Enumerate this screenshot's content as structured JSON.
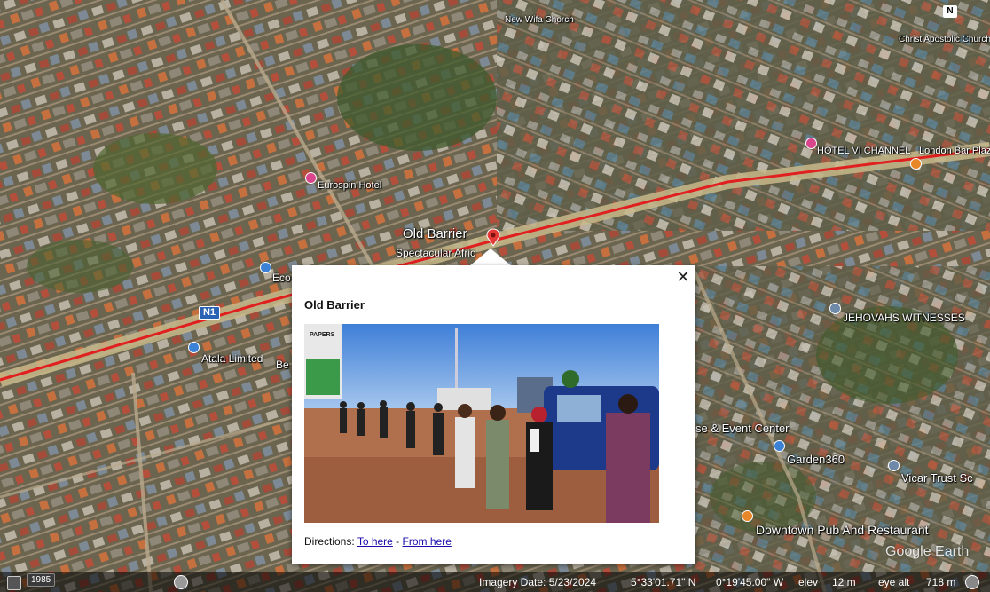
{
  "map": {
    "labels": {
      "new_life_chorch": "New Wifa Chorch",
      "christ_apostolic": "Christ Apostolic Church",
      "hotel": "HOTEL VI CHANNEL",
      "london_bar": "London Bar Plaz",
      "eurospin": "Eurospin Hotel",
      "old_barrier": "Old Barrier",
      "spectacular": "Spectacular Afric",
      "eco": "Eco",
      "atala": "Atala Limited",
      "be": "Be",
      "jehovah": "JEHOVAHS WITNESSES",
      "event_center": "se & Event Center",
      "garden": "Garden360",
      "vicar": "Vicar Trust Sc",
      "downtown": "Downtown Pub And Restaurant",
      "road_shield": "N1"
    },
    "compass": "N",
    "watermark": "Google Earth",
    "colors": {
      "road_line": "#e01f1f",
      "marker": "#e53935"
    }
  },
  "popup": {
    "title": "Old Barrier",
    "directions_prefix": "Directions: ",
    "to_here": "To here",
    "separator": " - ",
    "from_here": "From here",
    "close_symbol": "✕",
    "photo_billboard_text": "PAPERS"
  },
  "status_bar": {
    "year": "1985",
    "imagery_date": "Imagery Date: 5/23/2024",
    "lat": "5°33'01.71\" N",
    "lon": "0°19'45.00\" W",
    "elev_label": "elev",
    "elev_value": "12 m",
    "eye_alt_label": "eye alt",
    "eye_alt_value": "718 m"
  }
}
